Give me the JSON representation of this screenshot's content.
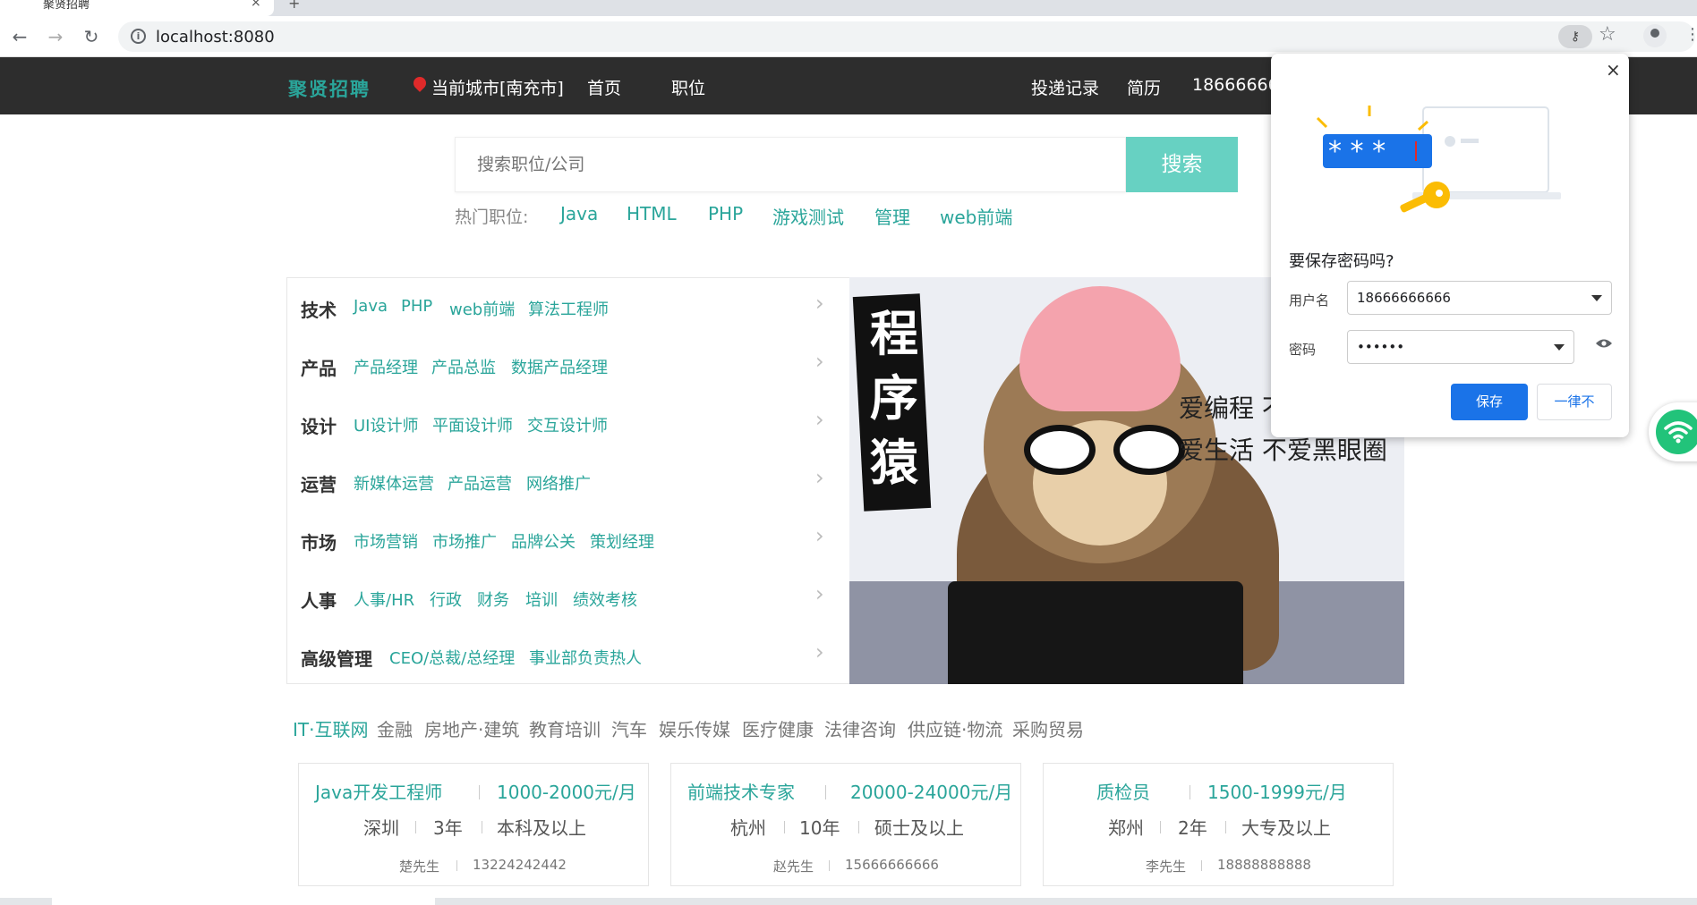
{
  "browser": {
    "tab_title": "聚贤招聘",
    "tab_close": "×",
    "new_tab": "+",
    "url": "localhost:8080",
    "info_glyph": "i",
    "back_glyph": "←",
    "forward_glyph": "→",
    "reload_glyph": "↻",
    "star_glyph": "☆",
    "menu_glyph": "⋮",
    "key_glyph": "⚷"
  },
  "header": {
    "logo": "聚贤招聘",
    "city": "当前城市[南充市]",
    "nav": {
      "home": "首页",
      "jobs": "职位",
      "records": "投递记录",
      "resume": "简历",
      "phone": "18666666666"
    }
  },
  "search": {
    "placeholder": "搜索职位/公司",
    "button": "搜索",
    "hot_label": "热门职位:",
    "hot": [
      "Java",
      "HTML",
      "PHP",
      "游戏测试",
      "管理",
      "web前端"
    ]
  },
  "categories": [
    {
      "name": "技术",
      "items": [
        "Java",
        "PHP",
        "web前端",
        "算法工程师"
      ]
    },
    {
      "name": "产品",
      "items": [
        "产品经理",
        "产品总监",
        "数据产品经理"
      ]
    },
    {
      "name": "设计",
      "items": [
        "UI设计师",
        "平面设计师",
        "交互设计师"
      ]
    },
    {
      "name": "运营",
      "items": [
        "新媒体运营",
        "产品运营",
        "网络推广"
      ]
    },
    {
      "name": "市场",
      "items": [
        "市场营销",
        "市场推广",
        "品牌公关",
        "策划经理"
      ]
    },
    {
      "name": "人事",
      "items": [
        "人事/HR",
        "行政",
        "财务",
        "培训",
        "绩效考核"
      ]
    },
    {
      "name": "高级管理",
      "items": [
        "CEO/总裁/总经理",
        "事业部负责热人"
      ]
    }
  ],
  "chevron": "›",
  "banner": {
    "sign": "程序猿",
    "line1": "爱编程 不",
    "line2": "爱生活 不爱黑眼圈"
  },
  "industries": [
    "IT·互联网",
    "金融",
    "房地产·建筑",
    "教育培训",
    "汽车",
    "娱乐传媒",
    "医疗健康",
    "法律咨询",
    "供应链·物流",
    "采购贸易"
  ],
  "jobs": [
    {
      "title": "Java开发工程师",
      "salary": "1000-2000元/月",
      "city": "深圳",
      "exp": "3年",
      "edu": "本科及以上",
      "contact": "楚先生",
      "phone": "13224242442"
    },
    {
      "title": "前端技术专家",
      "salary": "20000-24000元/月",
      "city": "杭州",
      "exp": "10年",
      "edu": "硕士及以上",
      "contact": "赵先生",
      "phone": "15666666666"
    },
    {
      "title": "质检员",
      "salary": "1500-1999元/月",
      "city": "郑州",
      "exp": "2年",
      "edu": "大专及以上",
      "contact": "李先生",
      "phone": "18888888888"
    }
  ],
  "password_dialog": {
    "close": "×",
    "title": "要保存密码吗?",
    "username_label": "用户名",
    "username": "18666666666",
    "password_label": "密码",
    "password": "••••••",
    "stars": "* * *",
    "save": "保存",
    "never": "一律不"
  },
  "colors": {
    "accent": "#2aa59a",
    "search_button": "#67d1c2",
    "header_bg": "#2d2d2d",
    "chrome_blue": "#1a73e8"
  }
}
